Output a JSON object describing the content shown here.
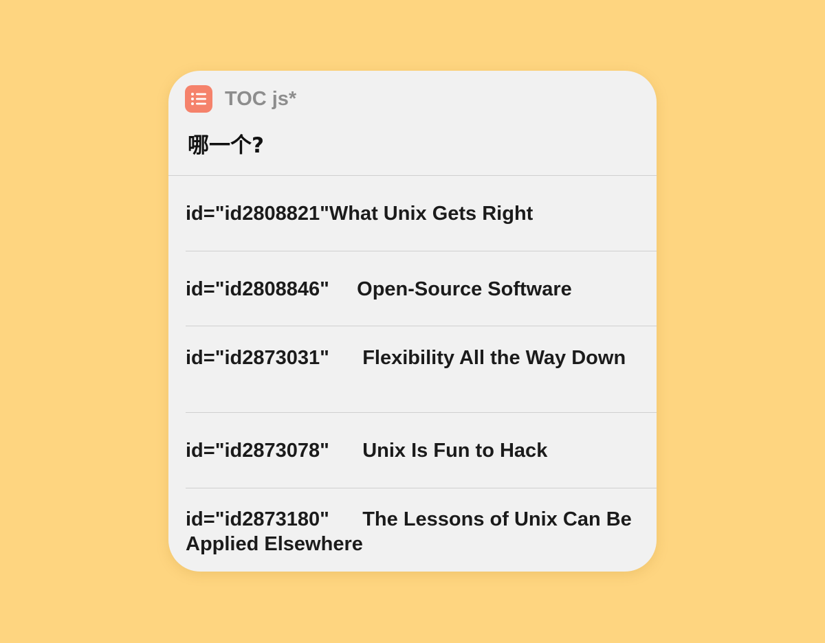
{
  "dialog": {
    "app_name": "TOC js*",
    "app_icon": "list-icon",
    "accent_color": "#f5826b",
    "prompt": "哪一个?",
    "items": [
      {
        "label": "id=\"id2808821\"What Unix Gets Right"
      },
      {
        "label": "id=\"id2808846\"     Open-Source Software"
      },
      {
        "label": "id=\"id2873031\"      Flexibility All the Way Down"
      },
      {
        "label": "id=\"id2873078\"      Unix Is Fun to Hack"
      },
      {
        "label": "id=\"id2873180\"      The Lessons of Unix Can Be Applied Elsewhere"
      }
    ]
  }
}
